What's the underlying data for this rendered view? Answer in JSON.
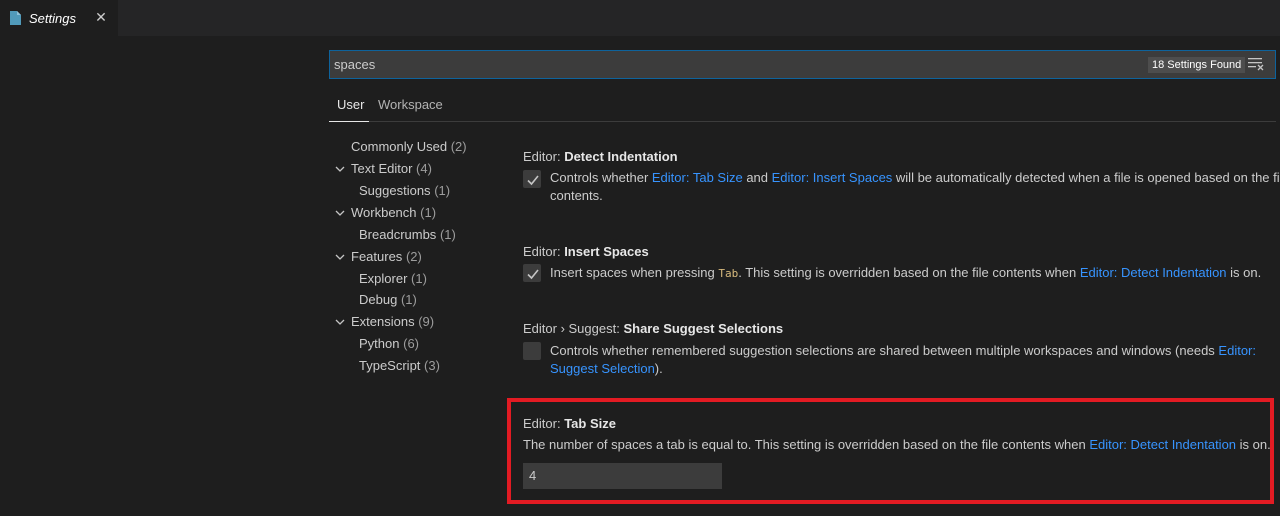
{
  "editor_tab": {
    "title": "Settings",
    "close_glyph": "✕",
    "icon": "file-icon"
  },
  "search": {
    "value": "spaces",
    "results_badge": "18 Settings Found",
    "clear_icon": "clear-filter-icon"
  },
  "scope_tabs": {
    "user": "User",
    "workspace": "Workspace"
  },
  "toc": [
    {
      "label": "Commonly Used",
      "count": "(2)",
      "expanded": null
    },
    {
      "label": "Text Editor",
      "count": "(4)",
      "expanded": true
    },
    {
      "label": "Suggestions",
      "count": "(1)",
      "expanded": null
    },
    {
      "label": "Workbench",
      "count": "(1)",
      "expanded": true
    },
    {
      "label": "Breadcrumbs",
      "count": "(1)",
      "expanded": null
    },
    {
      "label": "Features",
      "count": "(2)",
      "expanded": true
    },
    {
      "label": "Explorer",
      "count": "(1)",
      "expanded": null
    },
    {
      "label": "Debug",
      "count": "(1)",
      "expanded": null
    },
    {
      "label": "Extensions",
      "count": "(9)",
      "expanded": true
    },
    {
      "label": "Python",
      "count": "(6)",
      "expanded": null
    },
    {
      "label": "TypeScript",
      "count": "(3)",
      "expanded": null
    }
  ],
  "settings": {
    "detect_indentation": {
      "category": "Editor: ",
      "name": "Detect Indentation",
      "checked": true,
      "desc_1": "Controls whether ",
      "link_1": "Editor: Tab Size",
      "desc_2": " and ",
      "link_2": "Editor: Insert Spaces",
      "desc_3": " will be automatically detected when a file is opened based on the file",
      "desc_4": "contents."
    },
    "insert_spaces": {
      "category": "Editor: ",
      "name": "Insert Spaces",
      "checked": true,
      "desc_1": "Insert spaces when pressing ",
      "code": "Tab",
      "desc_2": ". This setting is overridden based on the file contents when ",
      "link_1": "Editor: Detect Indentation",
      "desc_3": " is on."
    },
    "share_suggest": {
      "category": "Editor › Suggest: ",
      "name": "Share Suggest Selections",
      "checked": false,
      "desc_1": "Controls whether remembered suggestion selections are shared between multiple workspaces and windows (needs ",
      "link_1a": "Editor:",
      "link_1b": "Suggest Selection",
      "desc_2": ")."
    },
    "tab_size": {
      "category": "Editor: ",
      "name": "Tab Size",
      "desc_1": "The number of spaces a tab is equal to. This setting is overridden based on the file contents when ",
      "link_1": "Editor: Detect Indentation",
      "desc_2": " is on.",
      "value": "4"
    }
  },
  "colors": {
    "accent_link": "#3794ff",
    "focus_border": "#0e639c",
    "highlight_box": "#e31b23"
  }
}
